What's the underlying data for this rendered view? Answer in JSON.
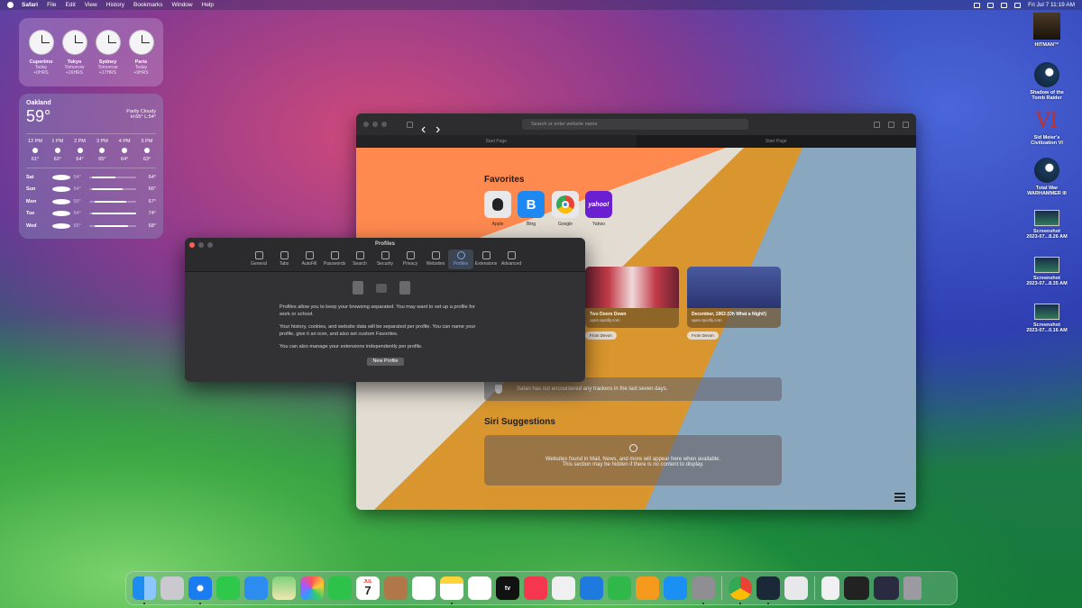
{
  "menubar": {
    "app": "Safari",
    "items": [
      "File",
      "Edit",
      "View",
      "History",
      "Bookmarks",
      "Window",
      "Help"
    ],
    "datetime": "Fri Jul 7  11:19 AM"
  },
  "clocks": [
    {
      "city": "Cupertino",
      "day": "Today",
      "offset": "+0HRS"
    },
    {
      "city": "Tokyo",
      "day": "Tomorrow",
      "offset": "+16HRS"
    },
    {
      "city": "Sydney",
      "day": "Tomorrow",
      "offset": "+17HRS"
    },
    {
      "city": "Paris",
      "day": "Today",
      "offset": "+9HRS"
    }
  ],
  "weather": {
    "location": "Oakland",
    "temp": "59°",
    "condition": "Partly Cloudy",
    "hilo": "H:65° L:54°",
    "hourly": [
      {
        "time": "12 PM",
        "temp": "61°"
      },
      {
        "time": "1 PM",
        "temp": "63°"
      },
      {
        "time": "2 PM",
        "temp": "64°"
      },
      {
        "time": "3 PM",
        "temp": "65°"
      },
      {
        "time": "4 PM",
        "temp": "64°"
      },
      {
        "time": "5 PM",
        "temp": "63°"
      }
    ],
    "daily": [
      {
        "day": "Sat",
        "lo": "54°",
        "hi": "64°",
        "bar_start": 0.05,
        "bar_end": 0.55
      },
      {
        "day": "Sun",
        "lo": "54°",
        "hi": "66°",
        "bar_start": 0.05,
        "bar_end": 0.7
      },
      {
        "day": "Mon",
        "lo": "55°",
        "hi": "67°",
        "bar_start": 0.1,
        "bar_end": 0.78
      },
      {
        "day": "Tue",
        "lo": "54°",
        "hi": "74°",
        "bar_start": 0.05,
        "bar_end": 1.0
      },
      {
        "day": "Wed",
        "lo": "55°",
        "hi": "68°",
        "bar_start": 0.1,
        "bar_end": 0.82
      }
    ]
  },
  "safari": {
    "url_placeholder": "Search or enter website name",
    "tabs": [
      "Start Page",
      "Start Page"
    ],
    "favorites_title": "Favorites",
    "favorites": [
      {
        "label": "Apple",
        "glyph": "",
        "color": "#e8e8ea"
      },
      {
        "label": "Bing",
        "glyph": "B",
        "color": "#1e87f0"
      },
      {
        "label": "Google",
        "glyph": "",
        "color": "#e8e8ea"
      },
      {
        "label": "Yahoo",
        "glyph": "yahoo!",
        "color": "#6a1fd1"
      }
    ],
    "shared": [
      {
        "title": "Two Doors Down",
        "url": "open.spotify.com",
        "from": "From Devon"
      },
      {
        "title": "December, 1963 (Oh What a Night!)",
        "url": "open.spotify.com",
        "from": "From Devon"
      }
    ],
    "privacy_text": "Safari has not encountered any trackers in the last seven days.",
    "siri_title": "Siri Suggestions",
    "siri_line1": "Websites found in Mail, News, and more will appear here when available.",
    "siri_line2": "This section may be hidden if there is no content to display."
  },
  "prefs": {
    "title": "Profiles",
    "tabs": [
      "General",
      "Tabs",
      "AutoFill",
      "Passwords",
      "Search",
      "Security",
      "Privacy",
      "Websites",
      "Profiles",
      "Extensions",
      "Advanced"
    ],
    "p1": "Profiles allow you to keep your browsing separated. You may want to set up a profile for work or school.",
    "p2": "Your history, cookies, and website data will be separated per profile. You can name your profile, give it an icon, and also set custom Favorites.",
    "p3": "You can also manage your extensions independently per profile.",
    "button": "New Profile"
  },
  "desktop": [
    {
      "label1": "HITMAN™",
      "label2": ""
    },
    {
      "label1": "Shadow of the",
      "label2": "Tomb Raider"
    },
    {
      "label1": "Sid Meier's",
      "label2": "Civilization VI",
      "glyph": "VI"
    },
    {
      "label1": "Total War",
      "label2": "WARHAMMER III"
    },
    {
      "label1": "Screenshot",
      "label2": "2023-07...8.26 AM"
    },
    {
      "label1": "Screenshot",
      "label2": "2023-07...8.35 AM"
    },
    {
      "label1": "Screenshot",
      "label2": "2023-07...0.16 AM"
    }
  ],
  "dock": {
    "calendar_month": "JUL",
    "calendar_day": "7",
    "tv_label": "tv"
  }
}
